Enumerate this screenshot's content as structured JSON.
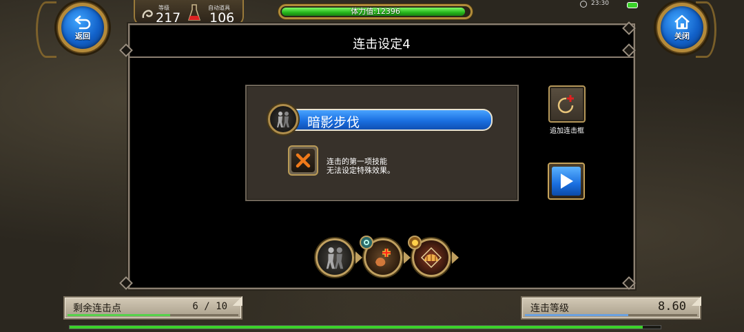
{
  "nav": {
    "back_label": "返回",
    "close_label": "关闭"
  },
  "stats": {
    "level_label": "等级",
    "level_value": "217",
    "auto_item_label": "自动道具",
    "auto_item_value": "106"
  },
  "stamina": {
    "text": "体力值:12396",
    "fill_percent": 98
  },
  "status": {
    "time": "23:30"
  },
  "panel": {
    "title": "连击设定4"
  },
  "combo": {
    "skill_name": "暗影步伐",
    "notice_line1": "连击的第一项技能",
    "notice_line2": "无法设定特殊效果。"
  },
  "side": {
    "add_frame_label": "追加连击框"
  },
  "chain": {
    "skills": [
      "shadow-step-icon",
      "heal-plus-icon",
      "dome-shield-icon"
    ]
  },
  "bottom": {
    "remaining_label": "剩余连击点",
    "remaining_value": "6 / 10",
    "remaining_percent": 60,
    "combo_level_label": "连击等级",
    "combo_level_value": "8.60",
    "combo_level_percent": 60
  },
  "colors": {
    "accent_blue": "#1a6fe0",
    "gold_frame": "#b48a3a",
    "stamina_green": "#25b51b"
  }
}
